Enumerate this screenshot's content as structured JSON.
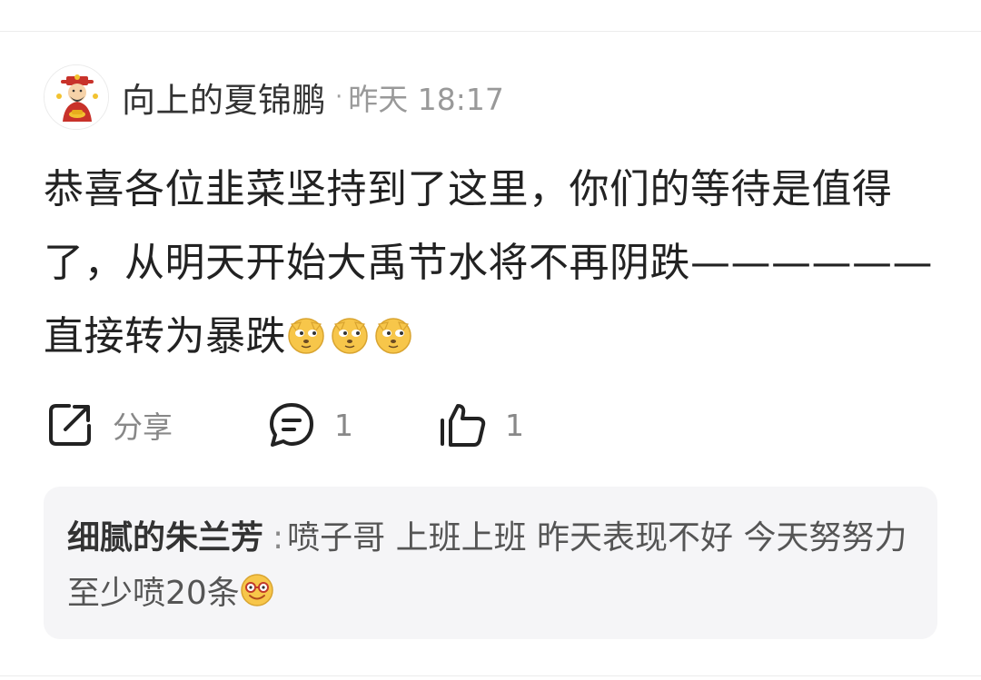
{
  "post": {
    "author": "向上的夏锦鹏",
    "separator": "·",
    "time": "昨天 18:17",
    "content": "恭喜各位韭菜坚持到了这里，你们的等待是值得了，从明天开始大禹节水将不再阴跌——————直接转为暴跌",
    "content_emojis": [
      "doge-emoji",
      "doge-emoji",
      "doge-emoji"
    ]
  },
  "actions": {
    "share_label": "分享",
    "comment_count": "1",
    "like_count": "1"
  },
  "reply": {
    "author": "细腻的朱兰芳",
    "separator": ":",
    "text": "喷子哥 上班上班 昨天表现不好 今天努努力 至少喷20条",
    "emoji": "smile-glasses-emoji"
  },
  "colors": {
    "text_primary": "#222222",
    "text_secondary": "#999999",
    "reply_background": "#f5f5f7",
    "emoji_yellow": "#f7c64a"
  }
}
